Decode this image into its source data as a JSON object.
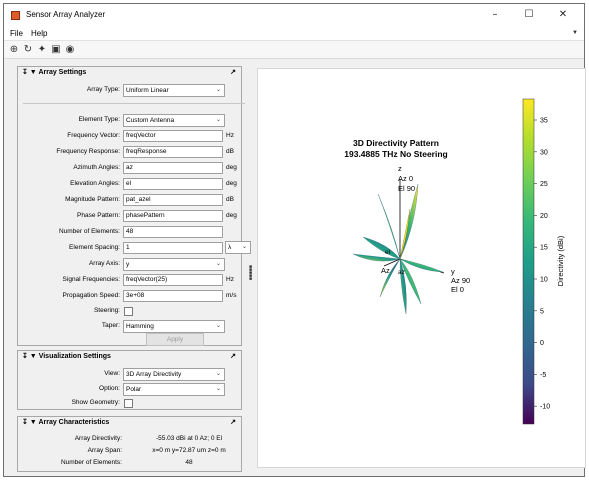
{
  "window": {
    "title": "Sensor Array Analyzer",
    "minimize": "–",
    "maximize": "☐",
    "close": "✕"
  },
  "menu": {
    "file": "File",
    "help": "Help"
  },
  "toolbar": {
    "icons": [
      "zoom-in-icon",
      "rotate-icon",
      "data-cursor-icon",
      "fit-view-icon",
      "default-view-icon"
    ]
  },
  "array_settings": {
    "header": "Array Settings",
    "array_type_label": "Array Type:",
    "array_type_value": "Uniform Linear",
    "element_type_label": "Element Type:",
    "element_type_value": "Custom Antenna",
    "fields": [
      {
        "label": "Frequency Vector:",
        "value": "freqVector",
        "unit": "Hz"
      },
      {
        "label": "Frequency Response:",
        "value": "freqResponse",
        "unit": "dB"
      },
      {
        "label": "Azimuth Angles:",
        "value": "az",
        "unit": "deg"
      },
      {
        "label": "Elevation Angles:",
        "value": "el",
        "unit": "deg"
      },
      {
        "label": "Magnitude Pattern:",
        "value": "pat_azel",
        "unit": "dB"
      },
      {
        "label": "Phase Pattern:",
        "value": "phasePattern",
        "unit": "deg"
      },
      {
        "label": "Number of Elements:",
        "value": "48",
        "unit": ""
      }
    ],
    "element_spacing_label": "Element Spacing:",
    "element_spacing_value": "1",
    "element_spacing_unit": "λ",
    "array_axis_label": "Array Axis:",
    "array_axis_value": "y",
    "signal_freq_label": "Signal Frequencies:",
    "signal_freq_value": "freqVector(25)",
    "signal_freq_unit": "Hz",
    "prop_speed_label": "Propagation Speed:",
    "prop_speed_value": "3e+08",
    "prop_speed_unit": "m/s",
    "steering_label": "Steering:",
    "taper_label": "Taper:",
    "taper_value": "Hamming",
    "apply_label": "Apply"
  },
  "visualization_settings": {
    "header": "Visualization Settings",
    "view_label": "View:",
    "view_value": "3D Array Directivity",
    "option_label": "Option:",
    "option_value": "Polar",
    "show_geometry_label": "Show Geometry:"
  },
  "array_characteristics": {
    "header": "Array Characteristics",
    "rows": [
      {
        "label": "Array Directivity:",
        "value": "-55.03 dBi at 0 Az; 0 El"
      },
      {
        "label": "Array Span:",
        "value": "x=0 m y=72.87 um z=0 m"
      },
      {
        "label": "Number of Elements:",
        "value": "48"
      }
    ]
  },
  "plot": {
    "title_line1": "3D Directivity Pattern",
    "title_line2": "193.4885 THz No Steering",
    "z_axis_label": "z",
    "z_az": "Az 0",
    "z_el": "El 90",
    "y_axis_label": "y",
    "y_az": "Az 90",
    "y_el": "El 0",
    "x_az_label": "Az",
    "x_el_label": "El 0",
    "small_el": "el",
    "small_az": "az",
    "colorbar_label": "Directivity (dBi)",
    "colorbar_ticks": [
      "35",
      "30",
      "25",
      "20",
      "15",
      "10",
      "5",
      "0",
      "-5",
      "-10"
    ],
    "colormap": [
      "#fde725",
      "#b5de2b",
      "#6ece58",
      "#35b779",
      "#1f9e89",
      "#26828e",
      "#31688e",
      "#3e4989",
      "#482878",
      "#440154"
    ]
  }
}
